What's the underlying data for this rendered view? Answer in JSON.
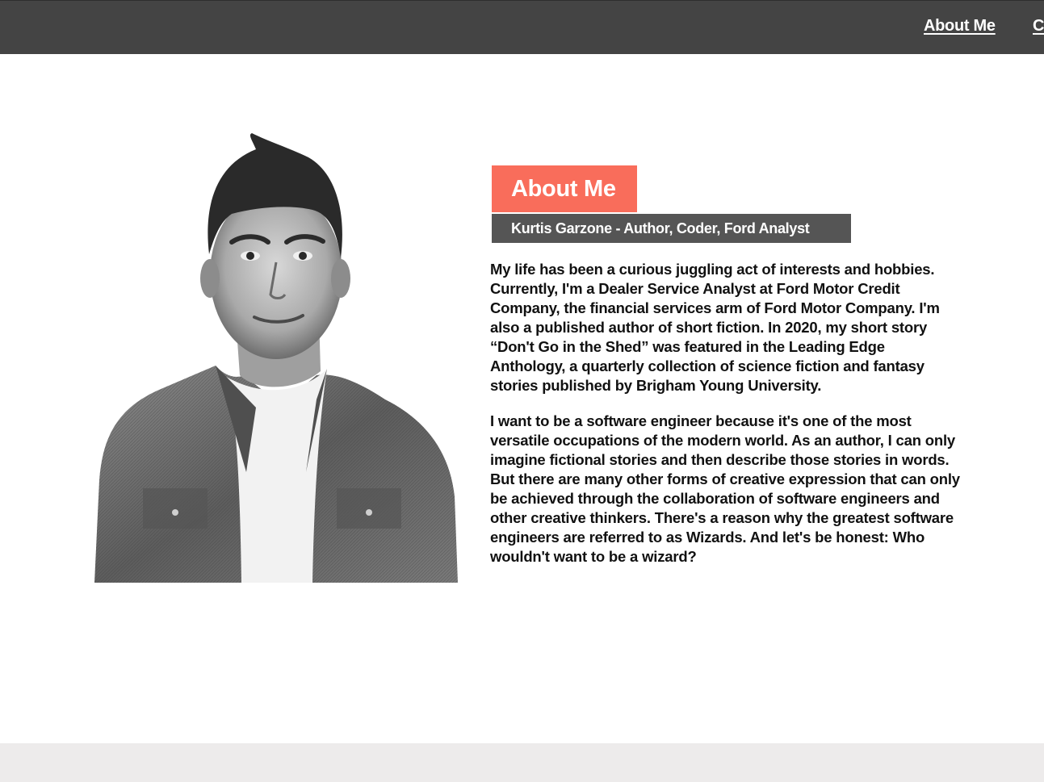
{
  "nav": {
    "links": [
      "About Me",
      "C"
    ]
  },
  "about": {
    "title": "About Me",
    "subtitle": "Kurtis Garzone - Author, Coder, Ford Analyst",
    "paragraphs": [
      "My life has been a curious juggling act of interests and hobbies. Currently, I'm a Dealer Service Analyst at Ford Motor Credit Company, the financial services arm of Ford Motor Company. I'm also a published author of short fiction. In 2020, my short story “Don't Go in the Shed” was featured in the Leading Edge Anthology, a quarterly collection of science fiction and fantasy stories published by Brigham Young University.",
      "I want to be a software engineer because it's one of the most versatile occupations of the modern world. As an author, I can only imagine fictional stories and then describe those stories in words. But there are many other forms of creative expression that can only be achieved through the collaboration of software engineers and other creative thinkers. There's a reason why the greatest software engineers are referred to as Wizards. And let's be honest: Who wouldn't want to be a wizard?"
    ]
  },
  "colors": {
    "topbar": "#444444",
    "accent": "#f96d5b",
    "subtitle_bg": "#555555",
    "footer": "#edebeb"
  }
}
